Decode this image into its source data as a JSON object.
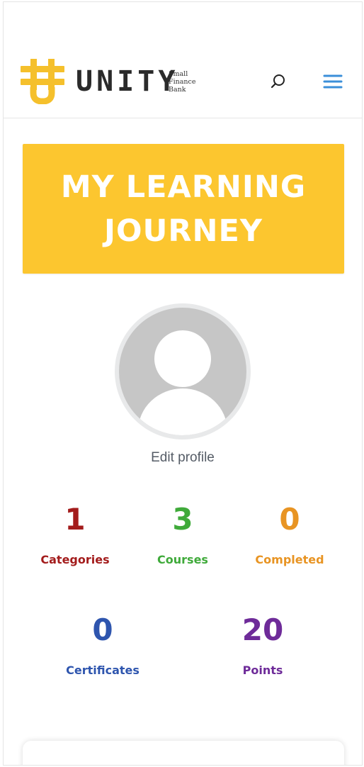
{
  "brand": {
    "name": "UNITY",
    "tagline": [
      "Small",
      "Finance",
      "Bank"
    ],
    "accent_color": "#fcc62f"
  },
  "header": {
    "search_icon": "search-icon",
    "menu_icon": "hamburger-menu-icon",
    "menu_color": "#3b8fd9"
  },
  "banner": {
    "line1": "MY LEARNING",
    "line2": "JOURNEY",
    "background": "#fcc62f"
  },
  "profile": {
    "avatar_icon": "user-avatar-placeholder",
    "edit_label": "Edit profile"
  },
  "stats": [
    {
      "value": "1",
      "label": "Categories",
      "color": "#a31c1c"
    },
    {
      "value": "3",
      "label": "Courses",
      "color": "#3faa3a"
    },
    {
      "value": "0",
      "label": "Completed",
      "color": "#e89423"
    },
    {
      "value": "0",
      "label": "Certificates",
      "color": "#2e55ae"
    },
    {
      "value": "20",
      "label": "Points",
      "color": "#6e2b99"
    }
  ]
}
